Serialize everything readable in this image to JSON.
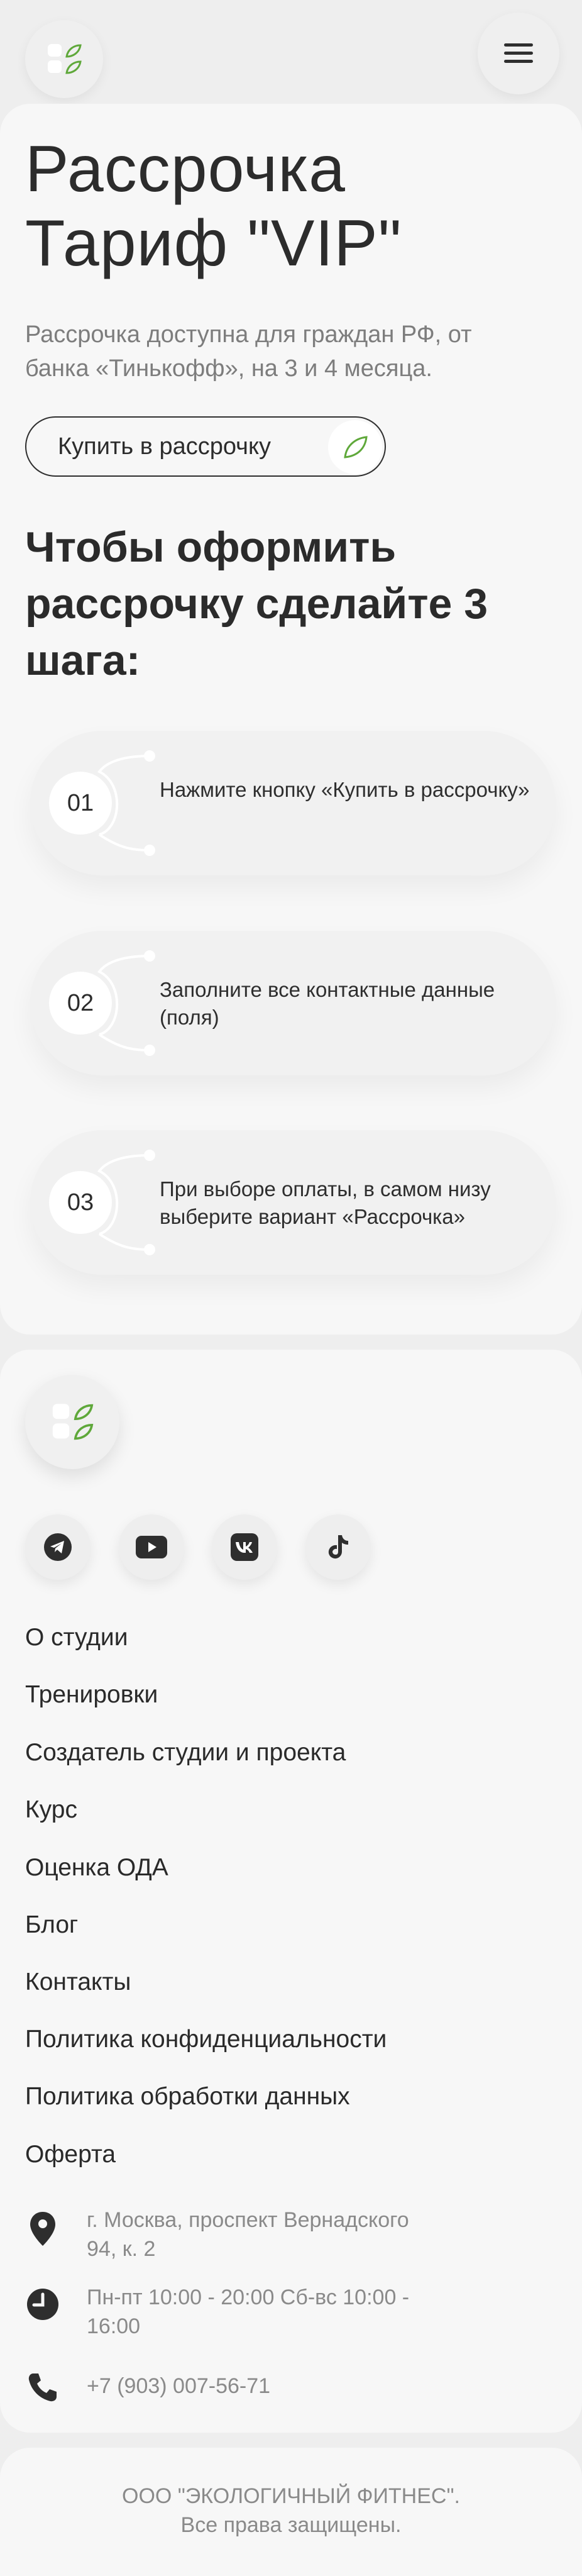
{
  "header": {
    "logo_icon": "studio-logo-icon",
    "menu_icon": "hamburger-menu-icon"
  },
  "hero": {
    "title": "Рассрочка Тариф \"VIP\"",
    "subtitle": "Рассрочка доступна для граждан РФ, от банка «Тинькофф», на 3 и 4 месяца.",
    "buy_button_label": "Купить в рассрочку",
    "buy_button_icon": "leaf-icon"
  },
  "steps": {
    "title": "Чтобы оформить рассрочку сделайте 3 шага:",
    "items": [
      {
        "number": "01",
        "text": "Нажмите кнопку «Купить в рассрочку»"
      },
      {
        "number": "02",
        "text": "Заполните все контактные данные (поля)"
      },
      {
        "number": "03",
        "text": "При выборе оплаты, в самом низу выберите вариант «Рассрочка»"
      }
    ]
  },
  "footer": {
    "social": [
      "telegram-icon",
      "youtube-icon",
      "vk-icon",
      "tiktok-icon"
    ],
    "nav": [
      "О студии",
      "Тренировки",
      "Создатель студии и проекта",
      "Курс",
      "Оценка ОДА",
      "Блог",
      "Контакты",
      "Политика конфиденциальности",
      "Политика обработки данных",
      "Оферта"
    ],
    "address": "г. Москва, проспект Вернадского 94, к. 2",
    "hours": "Пн-пт 10:00 - 20:00  Сб-вс 10:00 - 16:00",
    "phone": "+7 (903) 007-56-71"
  },
  "bottom": {
    "copyright_line1": "ООО \"ЭКОЛОГИЧНЫЙ ФИТНЕС\".",
    "copyright_line2": "Все права защищены."
  },
  "colors": {
    "background": "#eeeeee",
    "card": "#f7f7f7",
    "text": "#2b2b2b",
    "muted": "#8a8a8a",
    "accent_green": "#5fa83a"
  }
}
